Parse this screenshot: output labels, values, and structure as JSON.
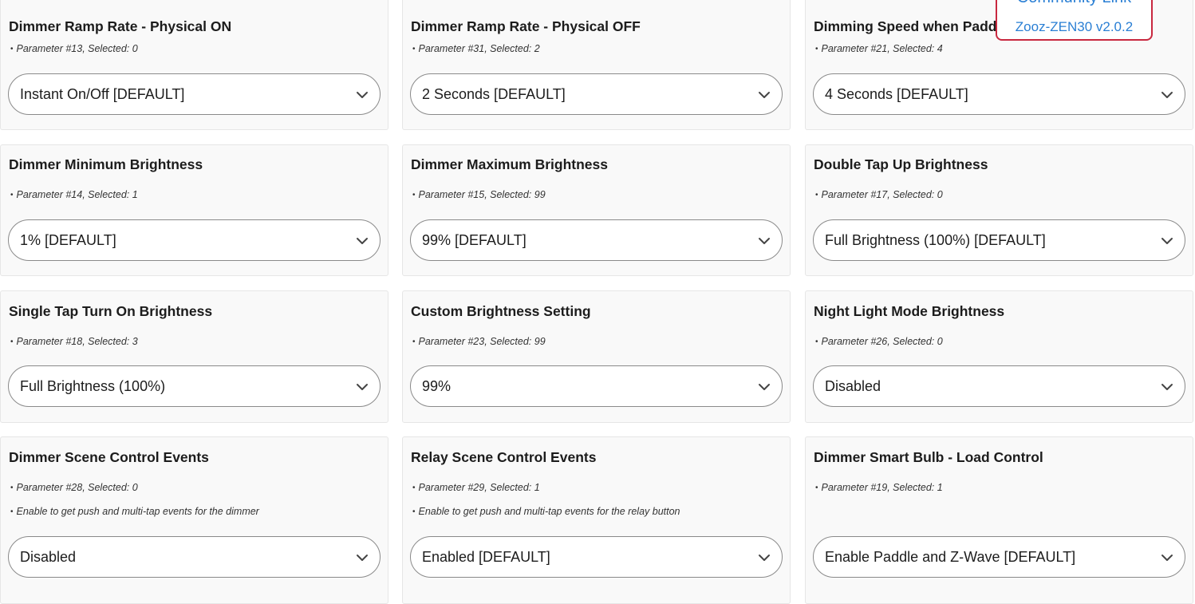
{
  "cards": [
    {
      "title": "Dimmer Ramp Rate - Physical ON",
      "notes": [
        "Parameter #13, Selected: 0"
      ],
      "value": "Instant On/Off [DEFAULT]"
    },
    {
      "title": "Dimmer Ramp Rate - Physical OFF",
      "notes": [
        "Parameter #31, Selected: 2"
      ],
      "value": "2 Seconds [DEFAULT]"
    },
    {
      "title": "Dimming Speed when Paddle is Held",
      "notes": [
        "Parameter #21, Selected: 4"
      ],
      "value": "4 Seconds [DEFAULT]"
    },
    {
      "title": "Dimmer Minimum Brightness",
      "notes": [
        "Parameter #14, Selected: 1"
      ],
      "value": "1% [DEFAULT]"
    },
    {
      "title": "Dimmer Maximum Brightness",
      "notes": [
        "Parameter #15, Selected: 99"
      ],
      "value": "99% [DEFAULT]"
    },
    {
      "title": "Double Tap Up Brightness",
      "notes": [
        "Parameter #17, Selected: 0"
      ],
      "value": "Full Brightness (100%) [DEFAULT]"
    },
    {
      "title": "Single Tap Turn On Brightness",
      "notes": [
        "Parameter #18, Selected: 3"
      ],
      "value": "Full Brightness (100%)"
    },
    {
      "title": "Custom Brightness Setting",
      "notes": [
        "Parameter #23, Selected: 99"
      ],
      "value": "99%"
    },
    {
      "title": "Night Light Mode Brightness",
      "notes": [
        "Parameter #26, Selected: 0"
      ],
      "value": "Disabled"
    },
    {
      "title": "Dimmer Scene Control Events",
      "notes": [
        "Parameter #28, Selected: 0",
        "Enable to get push and multi-tap events for the dimmer"
      ],
      "value": "Disabled"
    },
    {
      "title": "Relay Scene Control Events",
      "notes": [
        "Parameter #29, Selected: 1",
        "Enable to get push and multi-tap events for the relay button"
      ],
      "value": "Enabled [DEFAULT]"
    },
    {
      "title": "Dimmer Smart Bulb - Load Control",
      "notes": [
        "Parameter #19, Selected: 1"
      ],
      "value": "Enable Paddle and Z-Wave [DEFAULT]"
    }
  ],
  "popup": {
    "link_label": "Community Link",
    "version_label": "Zooz-ZEN30 v2.0.2"
  },
  "colors": {
    "accent_link": "#2a7fd4",
    "popup_border": "#c8283f"
  },
  "icons": {
    "select_arrow": "chevron-down-icon"
  }
}
